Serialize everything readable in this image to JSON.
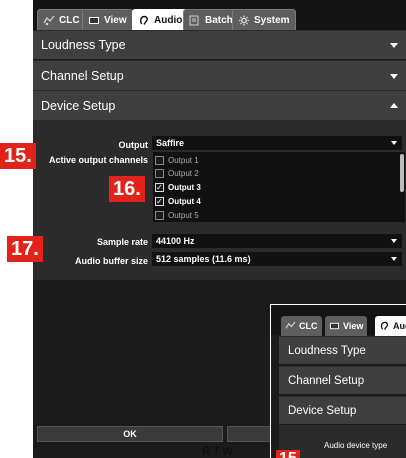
{
  "tabs": [
    {
      "label": "CLC",
      "icon": "clc-icon"
    },
    {
      "label": "View",
      "icon": "view-icon"
    },
    {
      "label": "Audio",
      "icon": "ear-icon",
      "active": true
    },
    {
      "label": "Batch",
      "icon": "batch-icon"
    },
    {
      "label": "System",
      "icon": "gear-icon"
    }
  ],
  "sections": {
    "loudness": "Loudness Type",
    "channel": "Channel Setup",
    "device": "Device Setup"
  },
  "device_setup": {
    "output_label": "Output",
    "output_value": "Saffire",
    "channels_label": "Active output channels",
    "channels": [
      {
        "label": "Output 1",
        "checked": false
      },
      {
        "label": "Output 2",
        "checked": false
      },
      {
        "label": "Output 3",
        "checked": true
      },
      {
        "label": "Output 4",
        "checked": true
      },
      {
        "label": "Output 5",
        "checked": false
      }
    ],
    "sample_rate_label": "Sample rate",
    "sample_rate_value": "44100 Hz",
    "buffer_label": "Audio buffer size",
    "buffer_value": "512 samples (11.6 ms)"
  },
  "badges": {
    "b15": "15.",
    "b16": "16.",
    "b17": "17.",
    "b15_overlay": "15"
  },
  "footer": {
    "ok_label": "OK",
    "logo": "RTW"
  },
  "overlay": {
    "tabs": [
      "CLC",
      "View",
      "Aud"
    ],
    "loudness": "Loudness Type",
    "channel": "Channel Setup",
    "device": "Device Setup",
    "device_type_label": "Audio device type"
  },
  "colors": {
    "accent": "#e2231a",
    "panel": "#3f3f3f",
    "background": "#1b1b1b"
  }
}
